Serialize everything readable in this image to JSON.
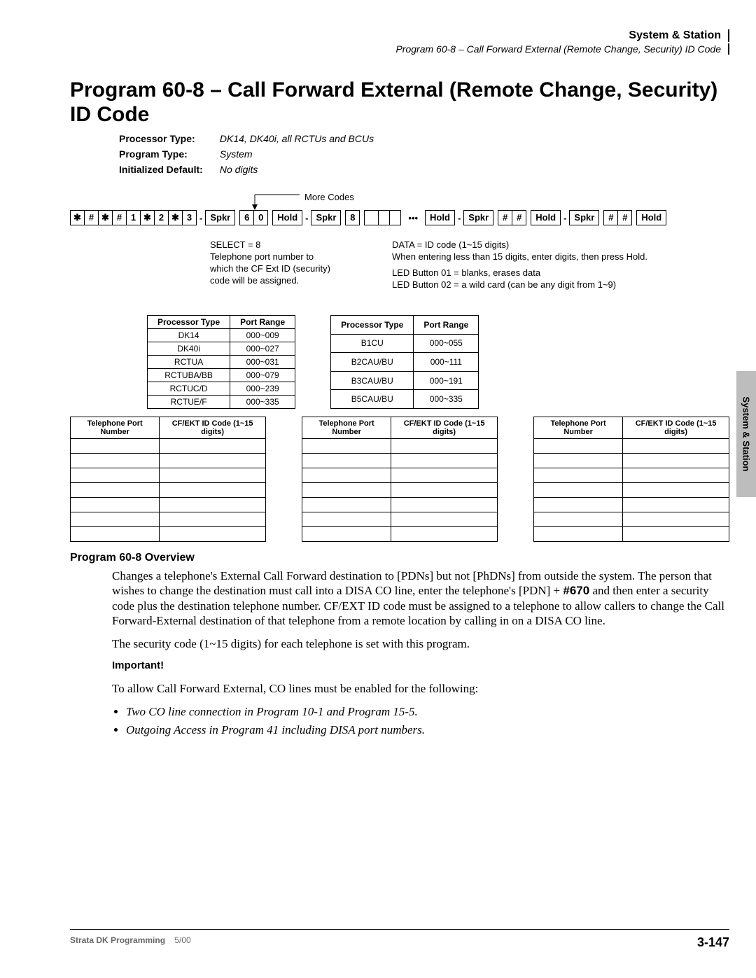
{
  "header": {
    "section": "System & Station",
    "sub": "Program 60-8 – Call Forward External (Remote Change, Security) ID Code"
  },
  "title": "Program 60-8 – Call Forward External (Remote Change, Security) ID Code",
  "meta": {
    "processor_type_label": "Processor Type:",
    "processor_type": "DK14, DK40i, all RCTUs and BCUs",
    "program_type_label": "Program Type:",
    "program_type": "System",
    "init_default_label": "Initialized Default:",
    "init_default": "No digits"
  },
  "sequence": {
    "more_codes": "More Codes",
    "keys1": [
      "✱",
      "#",
      "✱",
      "#",
      "1",
      "✱",
      "2",
      "✱",
      "3"
    ],
    "spkr": "Spkr",
    "hold": "Hold",
    "six": "6",
    "zero": "0",
    "eight": "8",
    "hash": "#"
  },
  "notes": {
    "select": "SELECT = 8",
    "tel_port_1": "Telephone port number to",
    "tel_port_2": "which the CF Ext ID (security)",
    "tel_port_3": "code will be assigned.",
    "data_1": "DATA = ID code (1~15 digits)",
    "data_2": "When entering less than 15 digits, enter digits, then press Hold.",
    "led01": "LED Button 01 = blanks, erases data",
    "led02": "LED Button 02 = a wild card (can be any digit from 1~9)"
  },
  "proc_tables": {
    "headers": [
      "Processor Type",
      "Port Range"
    ],
    "left": [
      [
        "DK14",
        "000~009"
      ],
      [
        "DK40i",
        "000~027"
      ],
      [
        "RCTUA",
        "000~031"
      ],
      [
        "RCTUBA/BB",
        "000~079"
      ],
      [
        "RCTUC/D",
        "000~239"
      ],
      [
        "RCTUE/F",
        "000~335"
      ]
    ],
    "right": [
      [
        "B1CU",
        "000~055"
      ],
      [
        "B2CAU/BU",
        "000~111"
      ],
      [
        "B3CAU/BU",
        "000~191"
      ],
      [
        "B5CAU/BU",
        "000~335"
      ]
    ]
  },
  "rec_headers": {
    "col1": "Telephone Port Number",
    "col2": "CF/EKT ID Code (1~15 digits)"
  },
  "overview": {
    "heading": "Program 60-8 Overview",
    "p1a": "Changes a telephone's External Call Forward destination to [PDNs] but not [PhDNs] from outside the system. The person that wishes to change the destination must call into a DISA CO line, enter the telephone's [PDN] + ",
    "hash670": "#670",
    "p1b": " and then enter a security code plus the destination telephone number. CF/EXT ID code must be assigned to a telephone to allow callers to change the Call Forward-External destination of that telephone from a remote location by calling in on a DISA CO line.",
    "p2": "The security code (1~15 digits) for each telephone is set with this program.",
    "important": "Important!",
    "p3": "To allow Call Forward External, CO lines must be enabled for the following:",
    "bullets": [
      "Two CO line connection in Program 10-1 and Program 15-5.",
      "Outgoing Access in Program 41 including DISA port numbers."
    ]
  },
  "sidetab": "System & Station",
  "footer": {
    "book": "Strata DK Programming",
    "date": "5/00",
    "page": "3-147"
  }
}
